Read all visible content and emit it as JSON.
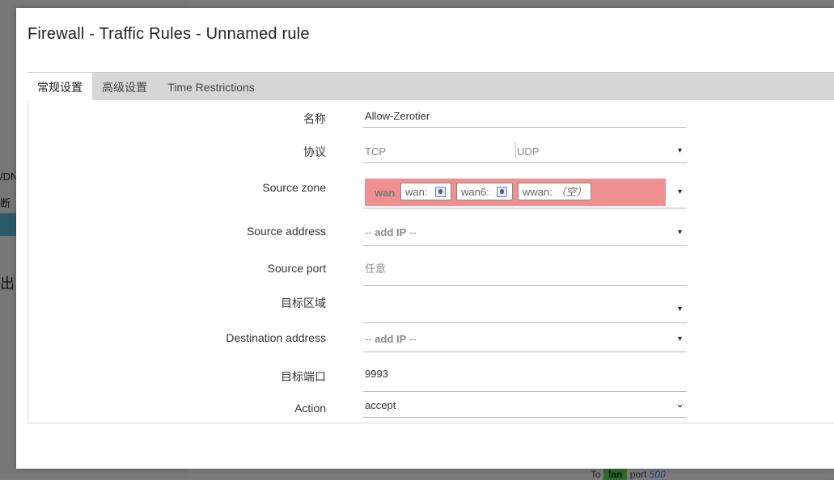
{
  "background": {
    "left_text_1": "/DN",
    "left_text_2": "断",
    "left_text_3": "出",
    "footer_to": "To",
    "footer_zone": "lan",
    "footer_port_label": "port",
    "footer_port_value": "500"
  },
  "modal": {
    "title": "Firewall - Traffic Rules - Unnamed rule",
    "tabs": [
      {
        "label": "常规设置",
        "active": true
      },
      {
        "label": "高级设置",
        "active": false
      },
      {
        "label": "Time Restrictions",
        "active": false
      }
    ]
  },
  "form": {
    "name": {
      "label": "名称",
      "value": "Allow-Zerotier"
    },
    "protocol": {
      "label": "协议",
      "option1": "TCP",
      "option2": "UDP"
    },
    "source_zone": {
      "label": "Source zone",
      "zone": "wan",
      "chips": [
        "wan:",
        "wan6:",
        "wwan:"
      ],
      "empty_label": "（空）"
    },
    "source_address": {
      "label": "Source address",
      "placeholder_prefix": "-- ",
      "placeholder_bold": "add IP",
      "placeholder_suffix": " --"
    },
    "source_port": {
      "label": "Source port",
      "placeholder": "任意"
    },
    "dest_zone": {
      "label": "目标区域",
      "value": ""
    },
    "dest_address": {
      "label": "Destination address",
      "placeholder_prefix": "-- ",
      "placeholder_bold": "add IP",
      "placeholder_suffix": " --"
    },
    "dest_port": {
      "label": "目标端口",
      "value": "9993"
    },
    "action": {
      "label": "Action",
      "value": "accept"
    }
  },
  "icons": {
    "dropdown": "▾",
    "chevron": "⌄"
  }
}
